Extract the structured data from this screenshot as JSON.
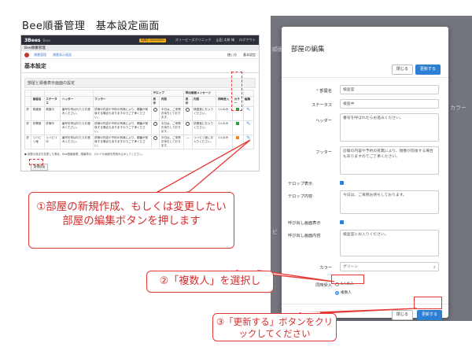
{
  "heading": "Bee順番管理　基本設定画面",
  "left": {
    "topbar": {
      "logo": "3Bees",
      "sub": "Bees",
      "badge": "利用中 00000000",
      "clinic": "スリービーズクリニック",
      "user": "山田 太郎 様",
      "logout": "ログアウト"
    },
    "subnav1": "Bee順番管理",
    "subnav2": {
      "link1": "順番管理",
      "link2": "順番表示画面",
      "help": "使い方",
      "settings": "基本設定"
    },
    "page_title": "基本設定",
    "section_title": "部屋と順番表示画面の設定",
    "table": {
      "group_headers": [
        "テロップ",
        "呼出画面メッセージ"
      ],
      "headers": [
        "部屋名",
        "ステータス",
        "ヘッダー",
        "フッター",
        "表示",
        "内容",
        "表示",
        "内容",
        "同時受入",
        "カラー",
        "編集"
      ],
      "rows": [
        {
          "no": "診",
          "name": "検査室",
          "status": "検査中",
          "header": "番号を呼ばれたらお進みください。",
          "footer": "診療の内容や予約の有無により、順番が前後する場合もありますのでご了承ください。",
          "telop": "今日は、ご来院お待ちしております。",
          "message": "検査室にお入りください。",
          "accept": "1人のみ",
          "color": "#2e9e44"
        },
        {
          "no": "診",
          "name": "診察室",
          "status": "診療中",
          "header": "番号を呼ばれたらお進みください。",
          "footer": "診療の内容や予約の有無により、順番が前後する場合もありますのでご了承ください。",
          "telop": "今日は、ご来院お待ちしております。",
          "message": "診察室にお入りください。",
          "accept": "1人のみ",
          "color": "#2e9e44"
        },
        {
          "no": "診",
          "name": "リハビリ室",
          "status": "リハビリ中",
          "header": "番号を呼ばれたらお進みください。",
          "footer": "診療の内容や予約の有無により、順番が前後する場合もありますのでご了承ください。",
          "telop": "今日は、ご来院お待ちしております。",
          "message": "リハビリ室にお入りください。",
          "accept": "1人のみ",
          "color": "#f08a1c"
        }
      ]
    },
    "note": "● 部屋の設定を変更した場合、Bee順番管理、順番表示、カルテの画面を再読み込みしてください。",
    "new_button": "新規追加"
  },
  "callout1": "①部屋の新規作成、もしくは変更したい部屋の編集ボタンを押します",
  "callout2": "②「複数人」を選択し",
  "callout3": "③「更新する」ボタンをクリックしてください",
  "modal": {
    "title": "部屋の編集",
    "close_label": "閉じる",
    "update_label": "更新する",
    "fields": {
      "room_name_label": "部屋名",
      "room_name_value": "検査室",
      "status_label": "ステータス",
      "status_value": "検査中",
      "header_label": "ヘッダー",
      "header_value": "番号を呼ばれたらお進みください。",
      "footer_label": "フッター",
      "footer_value": "診察の内容や予約の有無により、順番が前後する場合もありますのでご了承ください。",
      "telop_show_label": "テロップ表示",
      "telop_content_label": "テロップ内容",
      "telop_content_value": "今日は、ご来院お待ちしております。",
      "call_show_label": "呼び出し画面表示",
      "call_content_label": "呼び出し画面内容",
      "call_content_value": "検査室にお入りください。",
      "color_label": "カラー",
      "color_value": "グリーン",
      "accept_label": "同時受入",
      "accept_option1": "1人のみ",
      "accept_option2": "複数人"
    }
  },
  "background_fragments": [
    "順番",
    "カラー",
    "ビ"
  ]
}
